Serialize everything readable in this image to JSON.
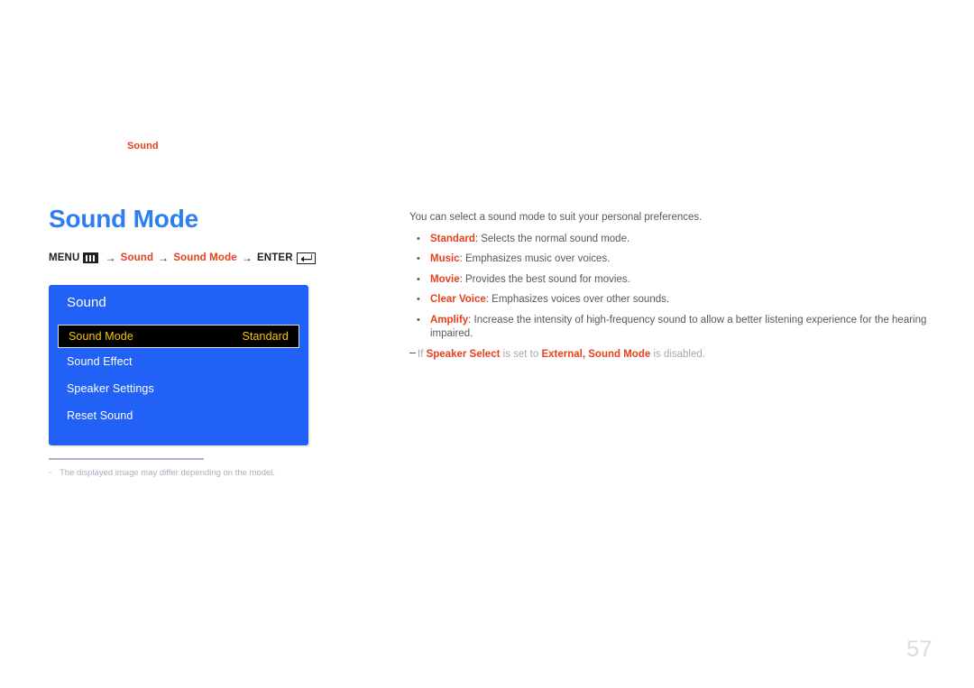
{
  "chapter": {
    "label": "Sound"
  },
  "page_title": "Sound Mode",
  "menu_path": {
    "menu_label": "MENU",
    "menu_icon": "menu-bars-icon",
    "arrow": "→",
    "segment_sound": "Sound",
    "segment_sound_mode": "Sound Mode",
    "enter_label": "ENTER",
    "enter_icon": "enter-return-icon"
  },
  "osd": {
    "title": "Sound",
    "items": [
      {
        "label": "Sound Mode",
        "value": "Standard",
        "selected": true
      },
      {
        "label": "Sound Effect",
        "value": "",
        "selected": false
      },
      {
        "label": "Speaker Settings",
        "value": "",
        "selected": false
      },
      {
        "label": "Reset Sound",
        "value": "",
        "selected": false
      }
    ]
  },
  "footnote": {
    "dash": "-",
    "text": "The displayed image may differ depending on the model."
  },
  "content": {
    "intro": "You can select a sound mode to suit your personal preferences.",
    "bullets": [
      {
        "dot": "•",
        "term": "Standard",
        "desc": ": Selects the normal sound mode."
      },
      {
        "dot": "•",
        "term": "Music",
        "desc": ": Emphasizes music over voices."
      },
      {
        "dot": "•",
        "term": "Movie",
        "desc": ": Provides the best sound for movies."
      },
      {
        "dot": "•",
        "term": "Clear Voice",
        "desc": ": Emphasizes voices over other sounds."
      },
      {
        "dot": "•",
        "term": "Amplify",
        "desc": ": Increase the intensity of high-frequency sound to allow a better listening experience for the hearing impaired."
      }
    ],
    "note": {
      "lead": "If ",
      "accent1": "Speaker Select",
      "mid1": " is set to ",
      "accent2": "External",
      "mid2": ", ",
      "accent3": "Sound Mode",
      "tail": " is disabled."
    }
  },
  "page_number": "57",
  "colors": {
    "accent_red": "#e8401c",
    "title_blue": "#2f7ef1",
    "panel_blue": "#2161f5",
    "selected_text": "#f7c600",
    "body_gray": "#58595b",
    "muted_gray": "#a9afc0"
  }
}
